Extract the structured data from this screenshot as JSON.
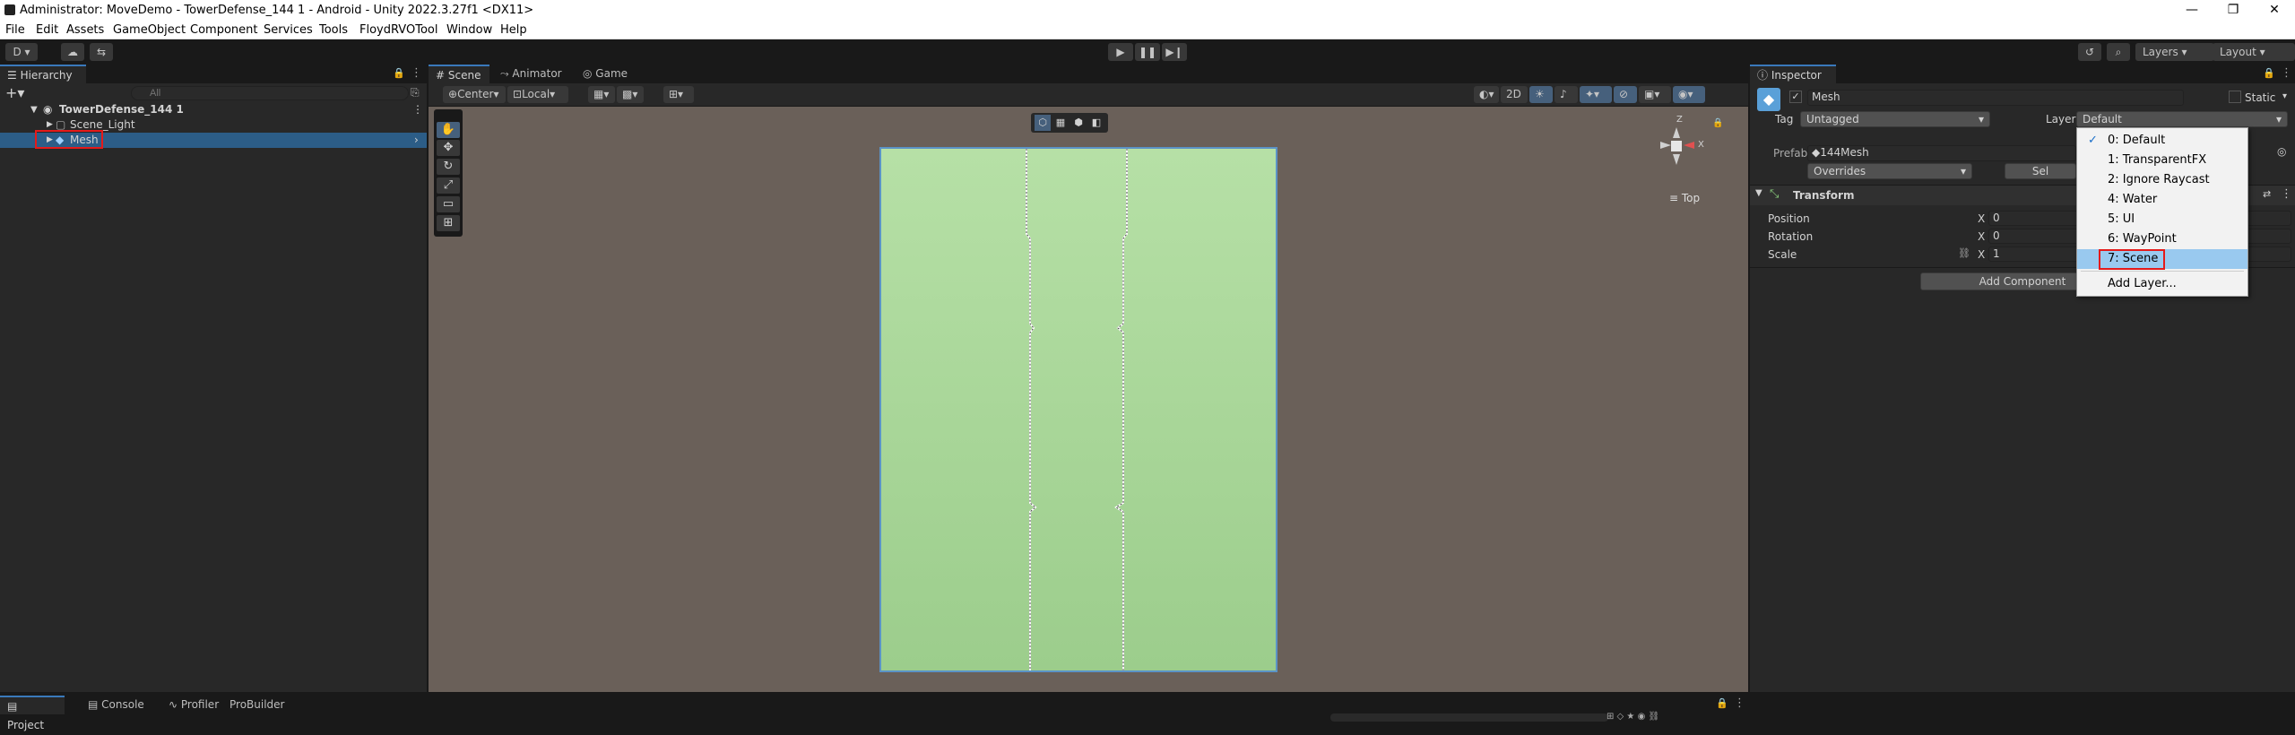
{
  "window": {
    "title": "Administrator: MoveDemo - TowerDefense_144 1 - Android - Unity 2022.3.27f1 <DX11>",
    "controls": [
      "—",
      "❐",
      "✕"
    ]
  },
  "menu": [
    "File",
    "Edit",
    "Assets",
    "GameObject",
    "Component",
    "Services",
    "Tools",
    "FloydRVOTool",
    "Window",
    "Help"
  ],
  "toolbar": {
    "account": "D ▾",
    "play": "▶",
    "pause": "❚❚",
    "step": "▶❙",
    "layers": "Layers",
    "layout": "Layout"
  },
  "hierarchy": {
    "tab": "Hierarchy",
    "search_placeholder": "All",
    "scene_name": "TowerDefense_144 1",
    "items": [
      "Scene_Light",
      "Mesh"
    ]
  },
  "scene_view": {
    "tabs": [
      "Scene",
      "Animator",
      "Game"
    ],
    "pivot": "Center",
    "space": "Local",
    "toggle_2d": "2D",
    "gizmo_label": "Top",
    "gizmo_axes": [
      "Z",
      "X"
    ]
  },
  "inspector": {
    "tab": "Inspector",
    "object_name": "Mesh",
    "static_label": "Static",
    "tag_label": "Tag",
    "tag_value": "Untagged",
    "layer_label": "Layer",
    "layer_value": "Default",
    "prefab_label": "Prefab",
    "prefab_value": "144Mesh",
    "overrides": "Overrides",
    "select_partial": "Sel",
    "transform_title": "Transform",
    "position_label": "Position",
    "rotation_label": "Rotation",
    "scale_label": "Scale",
    "axis_x": "X",
    "position_x": "0",
    "rotation_x": "0",
    "scale_x": "1",
    "add_component": "Add Component"
  },
  "layer_menu": {
    "items": [
      "0: Default",
      "1: TransparentFX",
      "2: Ignore Raycast",
      "4: Water",
      "5: UI",
      "6: WayPoint",
      "7: Scene"
    ],
    "add_layer": "Add Layer...",
    "checked": "0: Default",
    "highlighted": "7: Scene"
  },
  "bottom": {
    "tabs": [
      "Project",
      "Console",
      "Profiler",
      "ProBuilder"
    ]
  },
  "colors": {
    "accent": "#3a79bb",
    "selection": "#2c5d87",
    "highlight_menu": "#99c9ef",
    "annotation": "#e51a1a",
    "scene_bg": "#6a6059",
    "plane_green": "#a8d99a"
  }
}
